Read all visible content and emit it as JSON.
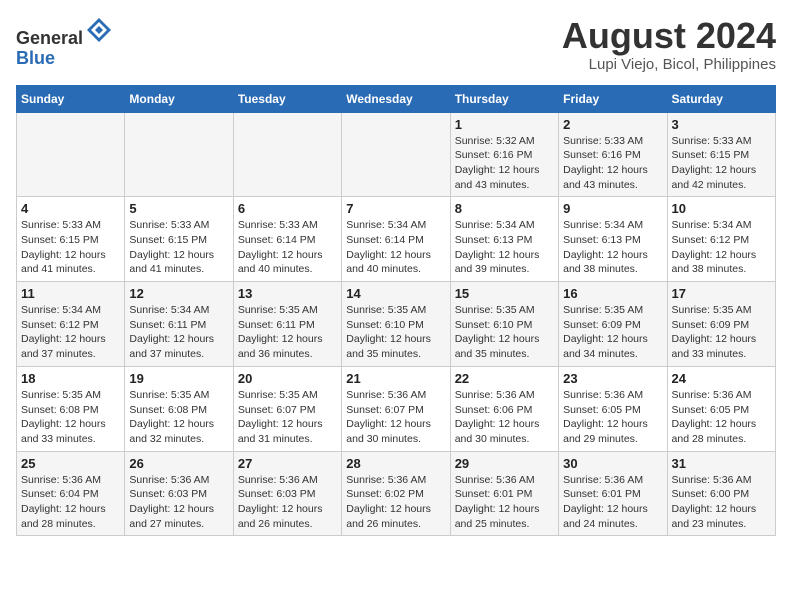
{
  "header": {
    "logo_line1": "General",
    "logo_line2": "Blue",
    "month_year": "August 2024",
    "location": "Lupi Viejo, Bicol, Philippines"
  },
  "days_of_week": [
    "Sunday",
    "Monday",
    "Tuesday",
    "Wednesday",
    "Thursday",
    "Friday",
    "Saturday"
  ],
  "weeks": [
    [
      {
        "day": "",
        "detail": ""
      },
      {
        "day": "",
        "detail": ""
      },
      {
        "day": "",
        "detail": ""
      },
      {
        "day": "",
        "detail": ""
      },
      {
        "day": "1",
        "detail": "Sunrise: 5:32 AM\nSunset: 6:16 PM\nDaylight: 12 hours\nand 43 minutes."
      },
      {
        "day": "2",
        "detail": "Sunrise: 5:33 AM\nSunset: 6:16 PM\nDaylight: 12 hours\nand 43 minutes."
      },
      {
        "day": "3",
        "detail": "Sunrise: 5:33 AM\nSunset: 6:15 PM\nDaylight: 12 hours\nand 42 minutes."
      }
    ],
    [
      {
        "day": "4",
        "detail": "Sunrise: 5:33 AM\nSunset: 6:15 PM\nDaylight: 12 hours\nand 41 minutes."
      },
      {
        "day": "5",
        "detail": "Sunrise: 5:33 AM\nSunset: 6:15 PM\nDaylight: 12 hours\nand 41 minutes."
      },
      {
        "day": "6",
        "detail": "Sunrise: 5:33 AM\nSunset: 6:14 PM\nDaylight: 12 hours\nand 40 minutes."
      },
      {
        "day": "7",
        "detail": "Sunrise: 5:34 AM\nSunset: 6:14 PM\nDaylight: 12 hours\nand 40 minutes."
      },
      {
        "day": "8",
        "detail": "Sunrise: 5:34 AM\nSunset: 6:13 PM\nDaylight: 12 hours\nand 39 minutes."
      },
      {
        "day": "9",
        "detail": "Sunrise: 5:34 AM\nSunset: 6:13 PM\nDaylight: 12 hours\nand 38 minutes."
      },
      {
        "day": "10",
        "detail": "Sunrise: 5:34 AM\nSunset: 6:12 PM\nDaylight: 12 hours\nand 38 minutes."
      }
    ],
    [
      {
        "day": "11",
        "detail": "Sunrise: 5:34 AM\nSunset: 6:12 PM\nDaylight: 12 hours\nand 37 minutes."
      },
      {
        "day": "12",
        "detail": "Sunrise: 5:34 AM\nSunset: 6:11 PM\nDaylight: 12 hours\nand 37 minutes."
      },
      {
        "day": "13",
        "detail": "Sunrise: 5:35 AM\nSunset: 6:11 PM\nDaylight: 12 hours\nand 36 minutes."
      },
      {
        "day": "14",
        "detail": "Sunrise: 5:35 AM\nSunset: 6:10 PM\nDaylight: 12 hours\nand 35 minutes."
      },
      {
        "day": "15",
        "detail": "Sunrise: 5:35 AM\nSunset: 6:10 PM\nDaylight: 12 hours\nand 35 minutes."
      },
      {
        "day": "16",
        "detail": "Sunrise: 5:35 AM\nSunset: 6:09 PM\nDaylight: 12 hours\nand 34 minutes."
      },
      {
        "day": "17",
        "detail": "Sunrise: 5:35 AM\nSunset: 6:09 PM\nDaylight: 12 hours\nand 33 minutes."
      }
    ],
    [
      {
        "day": "18",
        "detail": "Sunrise: 5:35 AM\nSunset: 6:08 PM\nDaylight: 12 hours\nand 33 minutes."
      },
      {
        "day": "19",
        "detail": "Sunrise: 5:35 AM\nSunset: 6:08 PM\nDaylight: 12 hours\nand 32 minutes."
      },
      {
        "day": "20",
        "detail": "Sunrise: 5:35 AM\nSunset: 6:07 PM\nDaylight: 12 hours\nand 31 minutes."
      },
      {
        "day": "21",
        "detail": "Sunrise: 5:36 AM\nSunset: 6:07 PM\nDaylight: 12 hours\nand 30 minutes."
      },
      {
        "day": "22",
        "detail": "Sunrise: 5:36 AM\nSunset: 6:06 PM\nDaylight: 12 hours\nand 30 minutes."
      },
      {
        "day": "23",
        "detail": "Sunrise: 5:36 AM\nSunset: 6:05 PM\nDaylight: 12 hours\nand 29 minutes."
      },
      {
        "day": "24",
        "detail": "Sunrise: 5:36 AM\nSunset: 6:05 PM\nDaylight: 12 hours\nand 28 minutes."
      }
    ],
    [
      {
        "day": "25",
        "detail": "Sunrise: 5:36 AM\nSunset: 6:04 PM\nDaylight: 12 hours\nand 28 minutes."
      },
      {
        "day": "26",
        "detail": "Sunrise: 5:36 AM\nSunset: 6:03 PM\nDaylight: 12 hours\nand 27 minutes."
      },
      {
        "day": "27",
        "detail": "Sunrise: 5:36 AM\nSunset: 6:03 PM\nDaylight: 12 hours\nand 26 minutes."
      },
      {
        "day": "28",
        "detail": "Sunrise: 5:36 AM\nSunset: 6:02 PM\nDaylight: 12 hours\nand 26 minutes."
      },
      {
        "day": "29",
        "detail": "Sunrise: 5:36 AM\nSunset: 6:01 PM\nDaylight: 12 hours\nand 25 minutes."
      },
      {
        "day": "30",
        "detail": "Sunrise: 5:36 AM\nSunset: 6:01 PM\nDaylight: 12 hours\nand 24 minutes."
      },
      {
        "day": "31",
        "detail": "Sunrise: 5:36 AM\nSunset: 6:00 PM\nDaylight: 12 hours\nand 23 minutes."
      }
    ]
  ]
}
